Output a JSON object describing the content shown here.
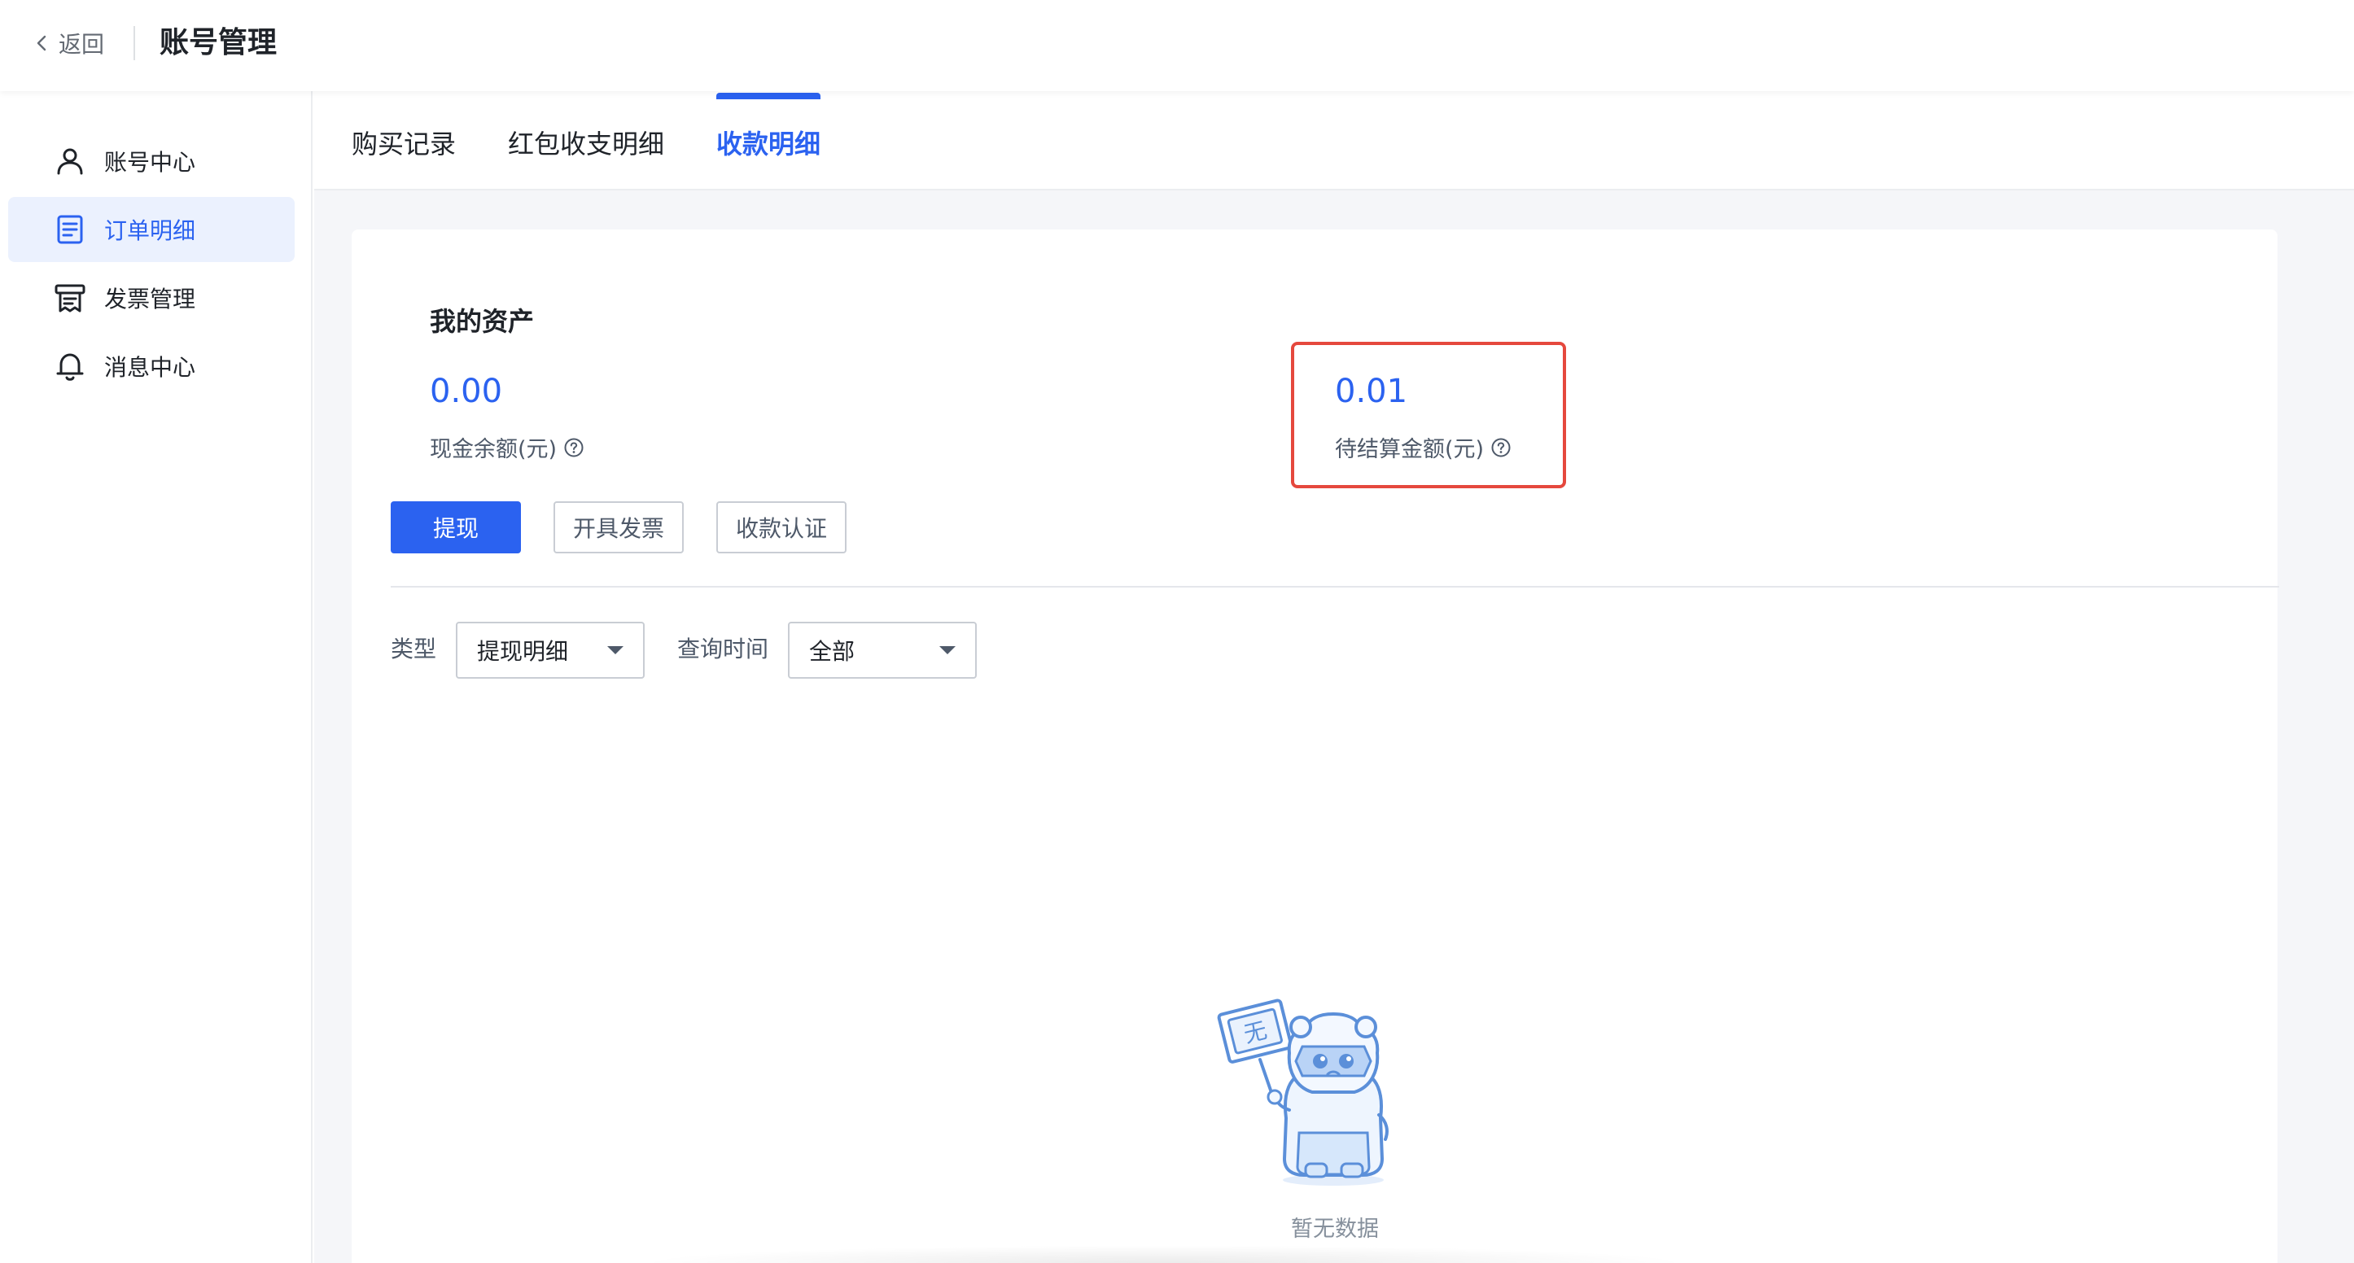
{
  "header": {
    "back_label": "返回",
    "title": "账号管理"
  },
  "sidebar": {
    "items": [
      {
        "label": "账号中心",
        "icon": "user-icon",
        "active": false
      },
      {
        "label": "订单明细",
        "icon": "order-list-icon",
        "active": true
      },
      {
        "label": "发票管理",
        "icon": "invoice-icon",
        "active": false
      },
      {
        "label": "消息中心",
        "icon": "bell-icon",
        "active": false
      }
    ]
  },
  "tabs": [
    {
      "label": "购买记录",
      "active": false
    },
    {
      "label": "红包收支明细",
      "active": false
    },
    {
      "label": "收款明细",
      "active": true
    }
  ],
  "assets": {
    "title": "我的资产",
    "cash_balance": {
      "value": "0.00",
      "label": "现金余额(元)"
    },
    "pending_amount": {
      "value": "0.01",
      "label": "待结算金额(元)",
      "highlighted": true
    }
  },
  "actions": {
    "withdraw": "提现",
    "invoice": "开具发票",
    "verify": "收款认证"
  },
  "filters": {
    "type_label": "类型",
    "type_value": "提现明细",
    "time_label": "查询时间",
    "time_value": "全部"
  },
  "empty_state": {
    "sign_text": "无",
    "message": "暂无数据"
  },
  "colors": {
    "accent": "#2b62f0",
    "highlight_border": "#e5483d"
  }
}
